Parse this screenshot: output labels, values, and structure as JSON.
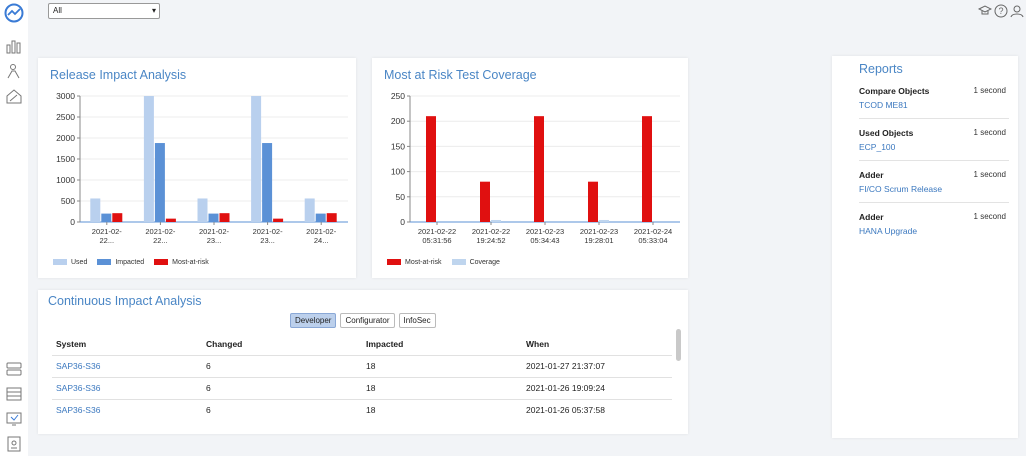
{
  "filter": {
    "value": "All"
  },
  "icons": {
    "logo": "app-logo-icon",
    "sidebar_top": [
      "bar-chart-icon",
      "person-chart-icon",
      "house-chart-icon"
    ],
    "sidebar_bottom": [
      "stack-icon",
      "list-icon",
      "monitor-icon",
      "document-icon"
    ],
    "topbar": [
      "graduation-cap-icon",
      "help-icon",
      "user-icon"
    ]
  },
  "colors": {
    "used": "#b9d0ee",
    "impacted": "#5b91d6",
    "risk": "#e01010",
    "coverage": "#bfd5ee",
    "accent": "#4a86c5"
  },
  "release_impact": {
    "title": "Release Impact Analysis",
    "legend": [
      "Used",
      "Impacted",
      "Most-at-risk"
    ]
  },
  "risk_coverage": {
    "title": "Most at Risk Test Coverage",
    "legend": [
      "Most-at-risk",
      "Coverage"
    ]
  },
  "chart_data": [
    {
      "type": "bar",
      "title": "Release Impact Analysis",
      "categories": [
        "2021-02-22...",
        "2021-02-22...",
        "2021-02-23...",
        "2021-02-23...",
        "2021-02-24..."
      ],
      "series": [
        {
          "name": "Used",
          "values": [
            560,
            3000,
            560,
            3000,
            560
          ]
        },
        {
          "name": "Impacted",
          "values": [
            200,
            1880,
            200,
            1880,
            200
          ]
        },
        {
          "name": "Most-at-risk",
          "values": [
            210,
            80,
            210,
            80,
            210
          ]
        }
      ],
      "yticks": [
        "3000",
        "2500",
        "2000",
        "1500",
        "1000",
        "500",
        "0"
      ],
      "ylim": [
        0,
        3000
      ],
      "grid": true,
      "legend_position": "bottom"
    },
    {
      "type": "bar",
      "title": "Most at Risk Test Coverage",
      "categories": [
        [
          "2021-02-22",
          "05:31:56"
        ],
        [
          "2021-02-22",
          "19:24:52"
        ],
        [
          "2021-02-23",
          "05:34:43"
        ],
        [
          "2021-02-23",
          "19:28:01"
        ],
        [
          "2021-02-24",
          "05:33:04"
        ]
      ],
      "series": [
        {
          "name": "Most-at-risk",
          "values": [
            210,
            80,
            210,
            80,
            210
          ]
        },
        {
          "name": "Coverage",
          "values": [
            0,
            4,
            0,
            4,
            0
          ]
        }
      ],
      "yticks": [
        "250",
        "200",
        "150",
        "100",
        "50",
        "0"
      ],
      "ylim": [
        0,
        250
      ],
      "grid": true,
      "legend_position": "bottom"
    }
  ],
  "reports": {
    "title": "Reports",
    "items": [
      {
        "type": "Compare Objects",
        "time": "1 second",
        "name": "TCOD ME81"
      },
      {
        "type": "Used Objects",
        "time": "1 second",
        "name": "ECP_100"
      },
      {
        "type": "Adder",
        "time": "1 second",
        "name": "FI/CO Scrum Release"
      },
      {
        "type": "Adder",
        "time": "1 second",
        "name": "HANA Upgrade"
      }
    ]
  },
  "continuous": {
    "title": "Continuous Impact Analysis",
    "tabs": [
      "Developer",
      "Configurator",
      "InfoSec"
    ],
    "active_tab": "Developer",
    "columns": [
      "System",
      "Changed",
      "Impacted",
      "When"
    ],
    "rows": [
      [
        "SAP36-S36",
        "6",
        "18",
        "2021-01-27 21:37:07"
      ],
      [
        "SAP36-S36",
        "6",
        "18",
        "2021-01-26 19:09:24"
      ],
      [
        "SAP36-S36",
        "6",
        "18",
        "2021-01-26 05:37:58"
      ]
    ]
  }
}
